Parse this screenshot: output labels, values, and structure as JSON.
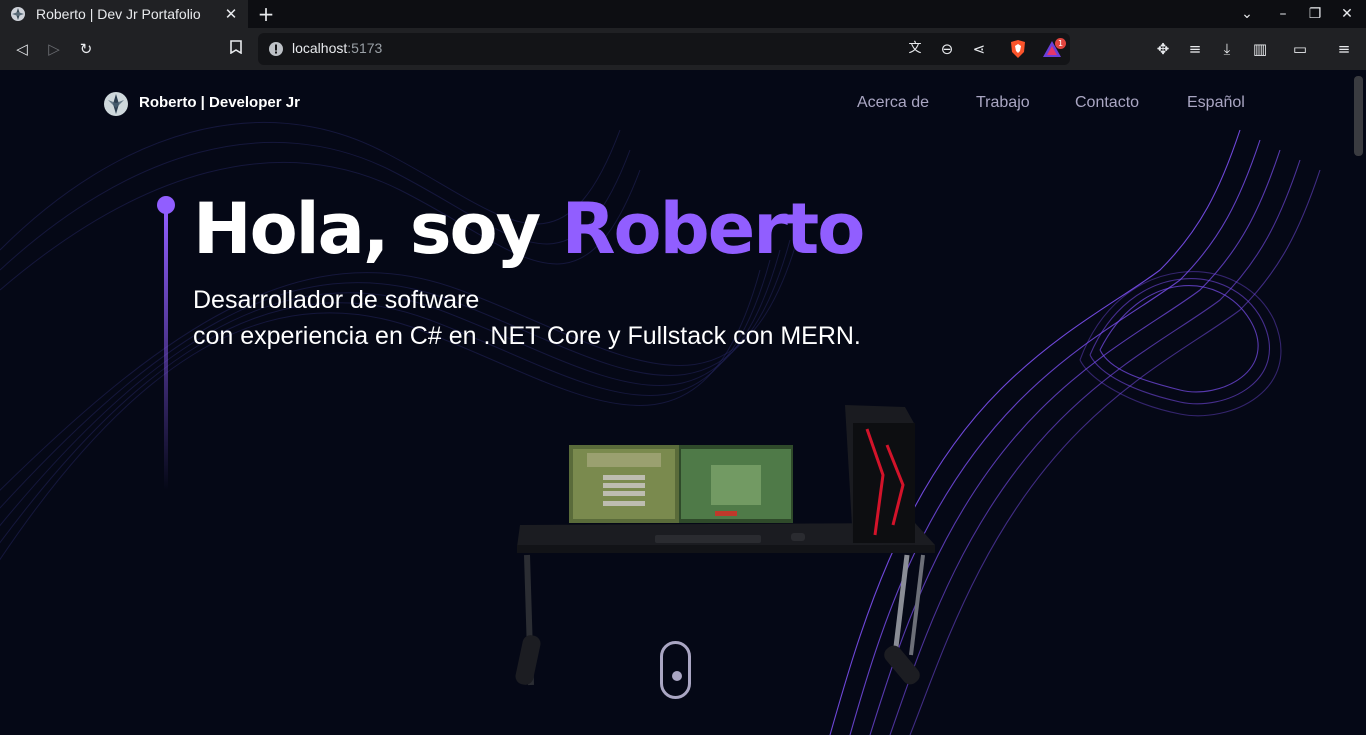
{
  "browser": {
    "tab_title": "Roberto | Dev Jr Portafolio",
    "url_host": "localhost",
    "url_port": ":5173",
    "brave_badge": "1"
  },
  "nav": {
    "brand": "Roberto  | Developer Jr",
    "links": [
      "Acerca de",
      "Trabajo",
      "Contacto",
      "Español"
    ]
  },
  "hero": {
    "title_prefix": "Hola, soy",
    "title_name": "Roberto",
    "subtitle_line1": "Desarrollador de software",
    "subtitle_line2": "con experiencia en C# en .NET Core y Fullstack con MERN."
  },
  "colors": {
    "accent": "#915eff",
    "background": "#050816",
    "secondary_text": "#aaa6c3"
  }
}
